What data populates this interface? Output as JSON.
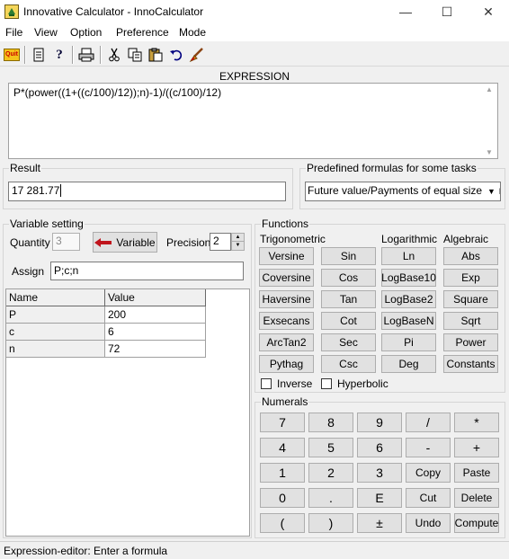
{
  "window": {
    "title": "Innovative Calculator - InnoCalculator",
    "minimize": "—",
    "maximize": "☐",
    "close": "✕"
  },
  "menu": [
    "File",
    "View",
    "Option",
    "Preference",
    "Mode"
  ],
  "toolbar": {
    "quit_label": "Quit",
    "icons": [
      "quit-icon",
      "properties-icon",
      "help-icon",
      "print-icon",
      "cut-icon",
      "copy-icon",
      "paste-icon",
      "undo-icon",
      "clear-icon"
    ]
  },
  "expression": {
    "label": "EXPRESSION",
    "value": "P*(power((1+((c/100)/12));n)-1)/((c/100)/12)"
  },
  "result": {
    "label": "Result",
    "value": "17 281.77"
  },
  "predefined": {
    "label": "Predefined formulas for some tasks",
    "selected": "Future value/Payments of equal size FVn"
  },
  "variables": {
    "group_label": "Variable setting",
    "quantity_label": "Quantity",
    "quantity_value": "3",
    "variable_button": "Variable",
    "precision_label": "Precision",
    "precision_value": "2",
    "assign_label": "Assign",
    "assign_value": "P;c;n",
    "columns": [
      "Name",
      "Value"
    ],
    "rows": [
      {
        "name": "P",
        "value": "200"
      },
      {
        "name": "c",
        "value": "6"
      },
      {
        "name": "n",
        "value": "72"
      }
    ]
  },
  "functions": {
    "group_label": "Functions",
    "trig_label": "Trigonometric",
    "log_label": "Logarithmic",
    "alg_label": "Algebraic",
    "col1": [
      "Versine",
      "Coversine",
      "Haversine",
      "Exsecans",
      "ArcTan2",
      "Pythag"
    ],
    "col2": [
      "Sin",
      "Cos",
      "Tan",
      "Cot",
      "Sec",
      "Csc"
    ],
    "col3": [
      "Ln",
      "LogBase10",
      "LogBase2",
      "LogBaseN",
      "Pi",
      "Deg"
    ],
    "col4": [
      "Abs",
      "Exp",
      "Square",
      "Sqrt",
      "Power",
      "Constants"
    ],
    "inverse_label": "Inverse",
    "hyperbolic_label": "Hyperbolic"
  },
  "numerals": {
    "group_label": "Numerals",
    "rows": [
      [
        "7",
        "8",
        "9",
        "/",
        "*"
      ],
      [
        "4",
        "5",
        "6",
        "-",
        "+"
      ],
      [
        "1",
        "2",
        "3",
        "Copy",
        "Paste"
      ],
      [
        "0",
        ".",
        "E",
        "Cut",
        "Delete"
      ],
      [
        "(",
        ")",
        "±",
        "Undo",
        "Compute"
      ]
    ]
  },
  "status": {
    "text": "Expression-editor: Enter a formula"
  },
  "colors": {
    "window_bg": "#f0f0f0",
    "button_bg": "#e1e1e1",
    "variable_arrow": "#c0141c"
  }
}
